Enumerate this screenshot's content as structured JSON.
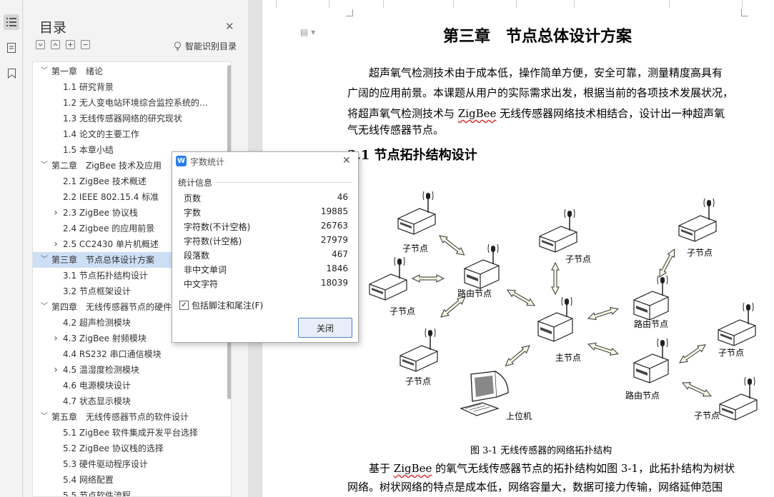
{
  "toc": {
    "title": "目录",
    "smart_label": "智能识别目录",
    "items": [
      {
        "text": "第一章　绪论",
        "level": 0,
        "arrow": "down",
        "selected": false
      },
      {
        "text": "1.1 研究背景",
        "level": 1,
        "arrow": "",
        "selected": false
      },
      {
        "text": "1.2  无人变电站环境综合监控系统的研究...",
        "level": 1,
        "arrow": "",
        "selected": false
      },
      {
        "text": "1.3  无线传感器网络的研究现状",
        "level": 1,
        "arrow": "",
        "selected": false
      },
      {
        "text": "1.4  论文的主要工作",
        "level": 1,
        "arrow": "",
        "selected": false
      },
      {
        "text": "1.5  本章小结",
        "level": 1,
        "arrow": "",
        "selected": false
      },
      {
        "text": "第二章　ZigBee 技术及应用",
        "level": 0,
        "arrow": "down",
        "selected": false
      },
      {
        "text": "2.1 ZigBee 技术概述",
        "level": 1,
        "arrow": "",
        "selected": false
      },
      {
        "text": "2.2 IEEE 802.15.4 标准",
        "level": 1,
        "arrow": "",
        "selected": false
      },
      {
        "text": "2.3 ZigBee 协议栈",
        "level": 1,
        "arrow": "right",
        "selected": false
      },
      {
        "text": "2.4 Zigbee  的应用前景",
        "level": 1,
        "arrow": "",
        "selected": false
      },
      {
        "text": "2.5 CC2430 单片机概述",
        "level": 1,
        "arrow": "right",
        "selected": false
      },
      {
        "text": "第三章　节点总体设计方案",
        "level": 0,
        "arrow": "down",
        "selected": true
      },
      {
        "text": "3.1  节点拓扑结构设计",
        "level": 1,
        "arrow": "",
        "selected": false
      },
      {
        "text": "3.2  节点框架设计",
        "level": 1,
        "arrow": "",
        "selected": false
      },
      {
        "text": "第四章　无线传感器节点的硬件",
        "level": 0,
        "arrow": "down",
        "selected": false
      },
      {
        "text": "4.2  超声检测模块",
        "level": 1,
        "arrow": "",
        "selected": false
      },
      {
        "text": "4.3 ZigBee 射频模块",
        "level": 1,
        "arrow": "right",
        "selected": false
      },
      {
        "text": "4.4 RS232 串口通信模块",
        "level": 1,
        "arrow": "",
        "selected": false
      },
      {
        "text": "4.5  温湿度检测模块",
        "level": 1,
        "arrow": "right",
        "selected": false
      },
      {
        "text": "4.6 电源模块设计",
        "level": 1,
        "arrow": "",
        "selected": false
      },
      {
        "text": "4.7 状态显示模块",
        "level": 1,
        "arrow": "",
        "selected": false
      },
      {
        "text": "第五章　无线传感器节点的软件设计",
        "level": 0,
        "arrow": "down",
        "selected": false
      },
      {
        "text": "5.1 ZigBee 软件集成开发平台选择",
        "level": 1,
        "arrow": "",
        "selected": false
      },
      {
        "text": "5.2 ZigBee 协议栈的选择",
        "level": 1,
        "arrow": "",
        "selected": false
      },
      {
        "text": "5.3 硬件驱动程序设计",
        "level": 1,
        "arrow": "",
        "selected": false
      },
      {
        "text": "5.4  网络配置",
        "level": 1,
        "arrow": "",
        "selected": false
      },
      {
        "text": "5.5  节点软件流程",
        "level": 1,
        "arrow": "",
        "selected": false
      }
    ]
  },
  "dialog": {
    "title": "字数统计",
    "section": "统计信息",
    "stats": [
      {
        "label": "页数",
        "value": "46"
      },
      {
        "label": "字数",
        "value": "19885"
      },
      {
        "label": "字符数(不计空格)",
        "value": "26763"
      },
      {
        "label": "字符数(计空格)",
        "value": "27979"
      },
      {
        "label": "段落数",
        "value": "467"
      },
      {
        "label": "非中文单词",
        "value": "1846"
      },
      {
        "label": "中文字符",
        "value": "18039"
      }
    ],
    "checkbox_label": "包括脚注和尾注(F)",
    "checkbox_checked": true,
    "close_label": "关闭"
  },
  "doc": {
    "chapter_title": "第三章　节点总体设计方案",
    "para1": [
      "　　超声氧气检测技术由于成本低，操作简单方便，安全可靠，测量精度高具有",
      "广阔的应用前景。本课题从用户的实际需求出发，根据当前的各项技术发展状况，",
      "将超声氧气检测技术与 ",
      "ZigBee",
      " 无线传感器网络技术相结合，设计出一种超声氧",
      "气无线传感器节点。"
    ],
    "section_title": "3.1  节点拓扑结构设计",
    "figure": {
      "labels": {
        "child": "子节点",
        "router": "路由节点",
        "main": "主节点",
        "host": "上位机"
      },
      "caption": "图 3-1 无线传感器的网络拓扑结构"
    },
    "para2": [
      "　　基于 ",
      "ZigBee",
      " 的氧气无线传感器节点的拓扑结构如图 3-1，此拓扑结构为树状",
      "网络。树状网络的特点是成本低，网络容量大，数据可接力传输，网络延伸范围"
    ]
  }
}
